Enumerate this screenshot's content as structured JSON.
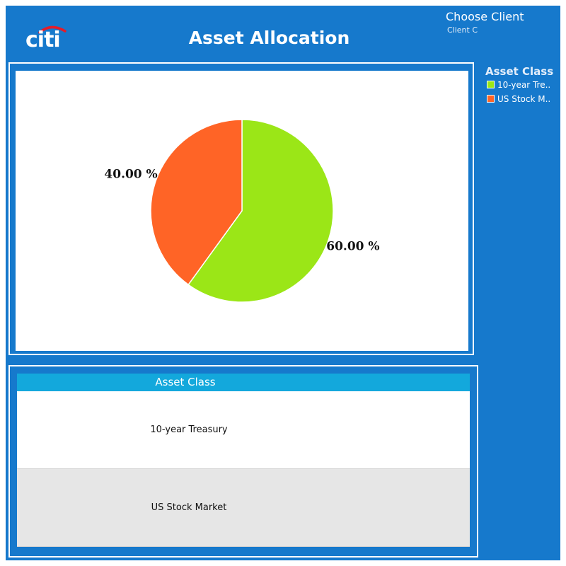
{
  "header": {
    "logo_text": "citi",
    "title": "Asset Allocation",
    "client_label": "Choose Client",
    "client_value": "Client C"
  },
  "colors": {
    "background": "#1679cc",
    "treasury": "#9be617",
    "stocks": "#ff6426",
    "header_cyan": "#13a8dc",
    "logo_arc": "#e31c2a"
  },
  "chart_data": {
    "type": "pie",
    "categories": [
      "10-year Treasury",
      "US Stock Market"
    ],
    "values": [
      60,
      40
    ],
    "labels": [
      "60.00 %",
      "40.00 %"
    ],
    "colors": [
      "#9be617",
      "#ff6426"
    ],
    "legend_title": "Asset Class",
    "legend_labels": [
      "10-year Tre..",
      "US Stock M.."
    ],
    "legend_position": "right"
  },
  "table": {
    "header": "Asset Class",
    "rows": [
      "10-year Treasury",
      "US Stock Market"
    ]
  }
}
